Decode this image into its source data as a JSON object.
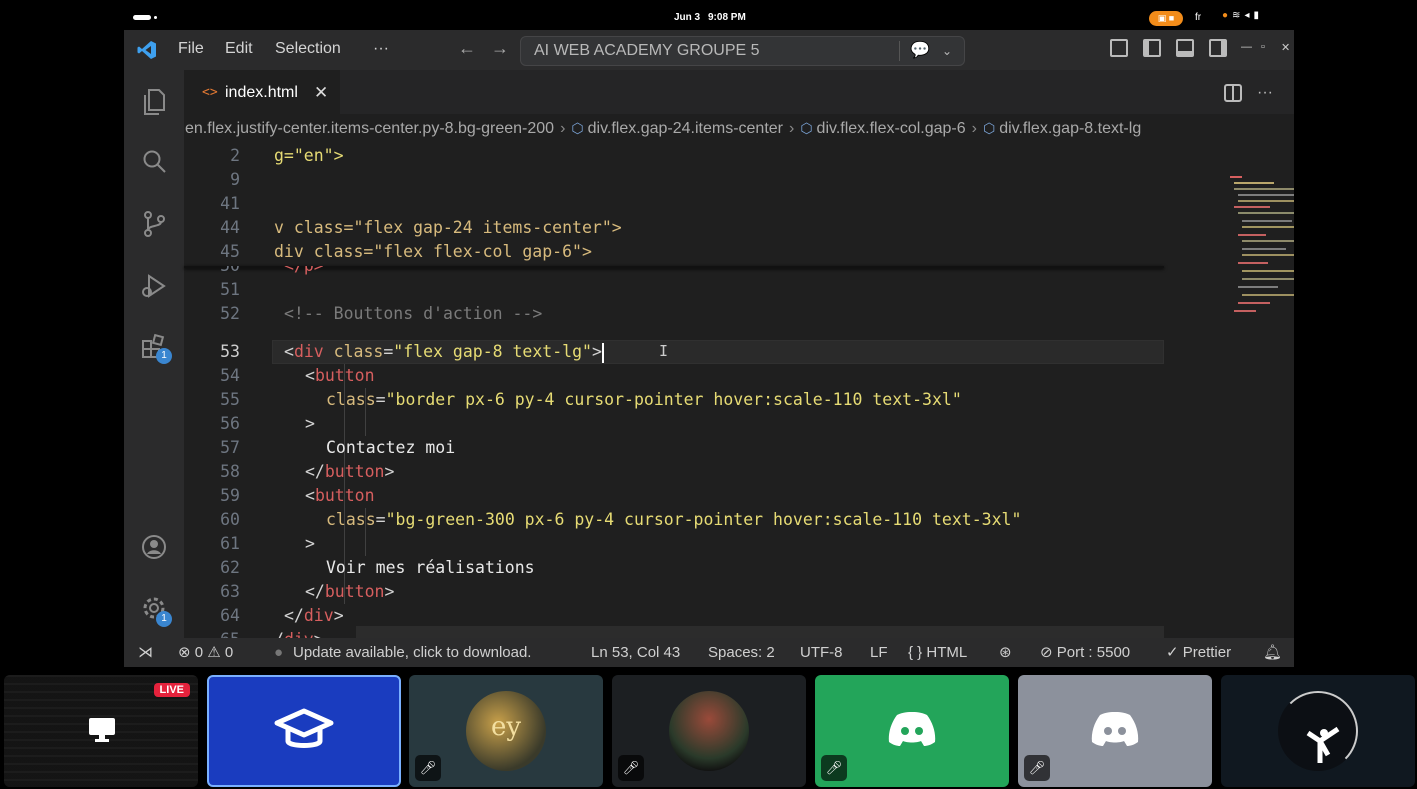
{
  "status_bar": {
    "date": "Jun 3",
    "time": "9:08 PM",
    "language": "fr"
  },
  "titlebar": {
    "menu": [
      "File",
      "Edit",
      "Selection",
      "···"
    ],
    "command_center": "AI WEB ACADEMY GROUPE 5"
  },
  "tab": {
    "filename": "index.html",
    "icon": "<>",
    "close": "✕"
  },
  "breadcrumb": [
    "en.flex.justify-center.items-center.py-8.bg-green-200",
    "div.flex.gap-24.items-center",
    "div.flex.flex-col.gap-6",
    "div.flex.gap-8.text-lg"
  ],
  "activity_badges": {
    "extensions": "1",
    "settings": "1"
  },
  "editor": {
    "sticky": [
      {
        "n": "2",
        "text": "g=\"en\">"
      },
      {
        "n": "9",
        "text": ""
      },
      {
        "n": "41",
        "text": ""
      },
      {
        "n": "44",
        "text": "v class=\"flex gap-24 items-center\">"
      },
      {
        "n": "45",
        "text": "div class=\"flex flex-col gap-6\">"
      }
    ],
    "lines": {
      "l50": {
        "n": "50",
        "text": "</p>"
      },
      "l51": {
        "n": "51"
      },
      "l52": {
        "n": "52",
        "text": "<!-- Bouttons d'action -->"
      },
      "l53": {
        "n": "53",
        "open": "<",
        "tag": "div",
        "attr": " class",
        "eq": "=",
        "val": "\"flex gap-8 text-lg\"",
        "close": ">"
      },
      "l54": {
        "n": "54",
        "open": "<",
        "tag": "button"
      },
      "l55": {
        "n": "55",
        "attr": "class",
        "eq": "=",
        "val": "\"border px-6 py-4 cursor-pointer hover:scale-110 text-3xl\""
      },
      "l56": {
        "n": "56",
        "text": ">"
      },
      "l57": {
        "n": "57",
        "text": "Contactez moi"
      },
      "l58": {
        "n": "58",
        "open": "</",
        "tag": "button",
        "close": ">"
      },
      "l59": {
        "n": "59",
        "open": "<",
        "tag": "button"
      },
      "l60": {
        "n": "60",
        "attr": "class",
        "eq": "=",
        "val": "\"bg-green-300 px-6 py-4 cursor-pointer hover:scale-110 text-3xl\""
      },
      "l61": {
        "n": "61",
        "text": ">"
      },
      "l62": {
        "n": "62",
        "text": "Voir mes réalisations"
      },
      "l63": {
        "n": "63",
        "open": "</",
        "tag": "button",
        "close": ">"
      },
      "l64": {
        "n": "64",
        "open": "</",
        "tag": "div",
        "close": ">"
      },
      "l65": {
        "n": "65",
        "open": "/",
        "tag": "div",
        "close": ">"
      }
    }
  },
  "statusline": {
    "errors": "0",
    "warnings": "0",
    "update": "Update available, click to download.",
    "position": "Ln 53, Col 43",
    "spaces": "Spaces: 2",
    "encoding": "UTF-8",
    "eol": "LF",
    "language": "HTML",
    "port": "Port : 5500",
    "prettier": "Prettier"
  },
  "participants": {
    "live": "LIVE"
  },
  "colors": {
    "accent": "#3a86d0",
    "tag": "#d75f5f",
    "string": "#e6db74",
    "attribute": "#d7ba7d",
    "live": "#e5223c",
    "discord_green": "#23a55a"
  }
}
